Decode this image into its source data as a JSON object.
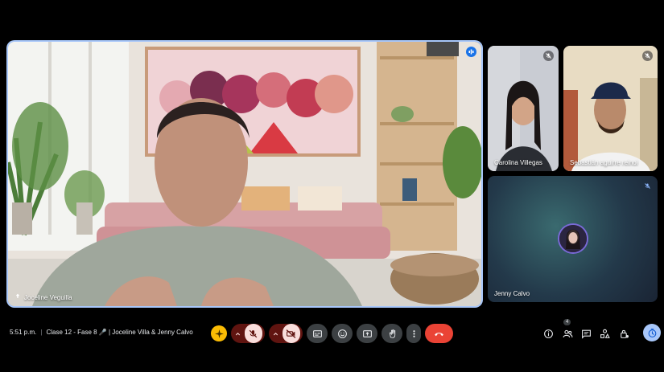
{
  "main_speaker": {
    "name": "Joceline Veguilla"
  },
  "participants": [
    {
      "name": "Carolina Villegas",
      "muted": true
    },
    {
      "name": "Sebastián aguirre reinoi",
      "muted": true
    },
    {
      "name": "Jenny Calvo",
      "muted": true
    }
  ],
  "meeting": {
    "time": "5:51 p.m.",
    "title": "Clase 12 - Fase 8 🎤 | Joceline Villa & Jenny Calvo"
  },
  "people_count": "4",
  "icons": {
    "pin": "pin-icon",
    "audio": "audio-wave-icon",
    "mic": "mic-off-icon",
    "cam": "camera-off-icon",
    "captions": "captions-icon",
    "emoji": "emoji-icon",
    "present": "present-icon",
    "hand": "raise-hand-icon",
    "more": "more-vert-icon",
    "leave": "call-end-icon",
    "info": "info-icon",
    "people": "people-icon",
    "chat": "chat-icon",
    "activities": "activities-icon",
    "lock": "host-controls-icon",
    "timer": "timer-icon"
  },
  "colors": {
    "accent": "#a8c7fa",
    "danger": "#ea4335",
    "muted_bg": "#f9dedc",
    "muted_dark": "#601410",
    "bar_button": "#3c4043"
  }
}
